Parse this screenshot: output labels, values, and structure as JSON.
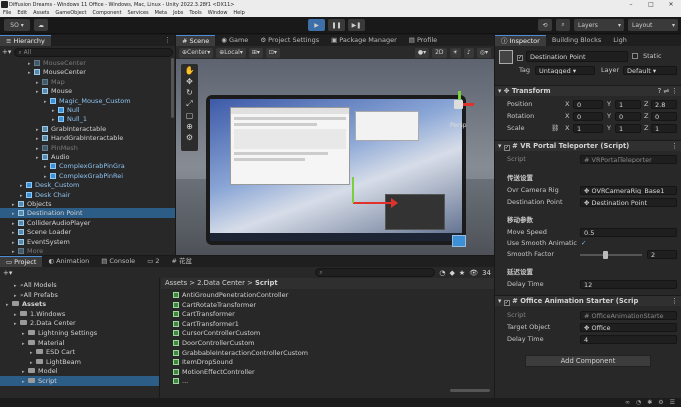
{
  "titlebar": {
    "title": "Diffusion Dreams - Windows 11 Office - Windows, Mac, Linux - Unity 2022.3.28f1 <DX11>",
    "min": "–",
    "max": "□",
    "close": "✕"
  },
  "menu": [
    "File",
    "Edit",
    "Assets",
    "GameObject",
    "Component",
    "Services",
    "Meta",
    "Jobs",
    "Tools",
    "Window",
    "Help"
  ],
  "toolbar": {
    "account": "SO",
    "layers": "Layers",
    "layout": "Layout"
  },
  "hierarchy": {
    "tab": "Hierarchy",
    "search_placeholder": "All",
    "rows": [
      {
        "label": "MouseCenter",
        "indent": 3,
        "style": "dim"
      },
      {
        "label": "MouseCenter",
        "indent": 3,
        "style": ""
      },
      {
        "label": "Map",
        "indent": 4,
        "style": "dim"
      },
      {
        "label": "Mouse",
        "indent": 4,
        "style": ""
      },
      {
        "label": "Magic_Mouse_Custom",
        "indent": 5,
        "style": "blue"
      },
      {
        "label": "Null",
        "indent": 6,
        "style": "blue"
      },
      {
        "label": "Null_1",
        "indent": 6,
        "style": "blue"
      },
      {
        "label": "GrabInteractable",
        "indent": 4,
        "style": ""
      },
      {
        "label": "HandGrabInteractable",
        "indent": 4,
        "style": ""
      },
      {
        "label": "PinMesh",
        "indent": 4,
        "style": "dim"
      },
      {
        "label": "Audio",
        "indent": 4,
        "style": ""
      },
      {
        "label": "ComplexGrabPinGra",
        "indent": 5,
        "style": "blue"
      },
      {
        "label": "ComplexGrabPinRei",
        "indent": 5,
        "style": "blue"
      },
      {
        "label": "Desk_Custom",
        "indent": 2,
        "style": "blue"
      },
      {
        "label": "Desk Chair",
        "indent": 2,
        "style": "blue"
      },
      {
        "label": "Objects",
        "indent": 1,
        "style": ""
      },
      {
        "label": "Destination Point",
        "indent": 1,
        "style": "selected"
      },
      {
        "label": "ColliderAudioPlayer",
        "indent": 1,
        "style": ""
      },
      {
        "label": "Scene Loader",
        "indent": 1,
        "style": ""
      },
      {
        "label": "EventSystem",
        "indent": 1,
        "style": ""
      },
      {
        "label": "More",
        "indent": 1,
        "style": "dim"
      }
    ]
  },
  "scene": {
    "tabs": [
      "Scene",
      "Game",
      "Project Settings",
      "Package Manager",
      "Profile"
    ],
    "pivot": "Center",
    "space": "Local",
    "mode": "2D",
    "persp": "Persp"
  },
  "project": {
    "tabs": [
      "Project",
      "Animation",
      "Console",
      "2",
      "花盆"
    ],
    "count": "34",
    "tree": [
      {
        "label": "All Models",
        "indent": 1
      },
      {
        "label": "All Prefabs",
        "indent": 1
      },
      {
        "label": "Assets",
        "indent": 0,
        "bold": true
      },
      {
        "label": "1.Windows",
        "indent": 1
      },
      {
        "label": "2.Data Center",
        "indent": 1
      },
      {
        "label": "Lightning Settings",
        "indent": 2
      },
      {
        "label": "Material",
        "indent": 2
      },
      {
        "label": "ESD Cart",
        "indent": 3
      },
      {
        "label": "LightBeam",
        "indent": 3
      },
      {
        "label": "Model",
        "indent": 2
      },
      {
        "label": "Script",
        "indent": 2,
        "selected": true
      }
    ],
    "breadcrumb": [
      "Assets",
      "2.Data Center",
      "Script"
    ],
    "files": [
      "AntiGroundPenetrationController",
      "CartRotateTransformer",
      "CartTransformer",
      "CartTransformer1",
      "CursorControllerCustom",
      "DoorControllerCustom",
      "GrabbableInteractionControllerCustom",
      "ItemDropSound",
      "MotionEffectController",
      "..."
    ]
  },
  "inspector": {
    "tabs": [
      "Inspector",
      "Building Blocks",
      "Ligh"
    ],
    "name": "Destination Point",
    "static_label": "Static",
    "tag_label": "Tag",
    "tag": "Untagged",
    "layer_label": "Layer",
    "layer": "Default",
    "transform": {
      "title": "Transform",
      "position": {
        "label": "Position",
        "x": "0",
        "y": "1",
        "z": "2.8"
      },
      "rotation": {
        "label": "Rotation",
        "x": "0",
        "y": "0",
        "z": "0"
      },
      "scale": {
        "label": "Scale",
        "x": "1",
        "y": "1",
        "z": "1"
      }
    },
    "vr": {
      "title": "VR Portal Teleporter (Script)",
      "script_label": "Script",
      "script": "VRPortalTeleporter",
      "section1": "传送设置",
      "ovr_label": "Ovr Camera Rig",
      "ovr": "OVRCameraRig_Base1",
      "dest_label": "Destination Point",
      "dest": "Destination Point",
      "section2": "移动参数",
      "move_label": "Move Speed",
      "move": "0.5",
      "smooth_label": "Use Smooth Animatic",
      "sfactor_label": "Smooth Factor",
      "sfactor": "2",
      "section3": "延迟设置",
      "delay_label": "Delay Time",
      "delay": "12"
    },
    "office": {
      "title": "Office Animation Starter (Scrip",
      "script_label": "Script",
      "script": "OfficeAnimationStarte",
      "target_label": "Target Object",
      "target": "Office",
      "delay_label": "Delay Time",
      "delay": "4"
    },
    "add_component": "Add Component"
  },
  "colors": {
    "selection": "#2c5d87",
    "accent": "#4c8cd8",
    "panel": "#282828"
  }
}
